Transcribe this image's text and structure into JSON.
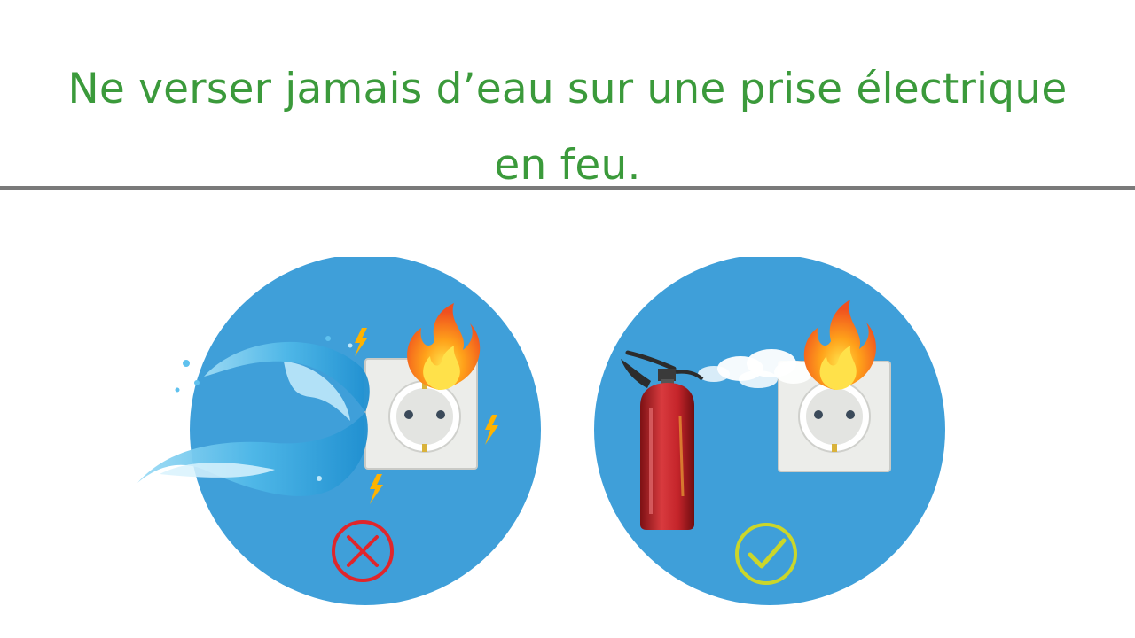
{
  "slide": {
    "title_line1": "Ne verser jamais d’eau sur une prise électrique",
    "title_line2": "en feu."
  },
  "panels": [
    {
      "id": "wrong",
      "depicts": [
        "water-splash-icon",
        "electrical-outlet-icon",
        "fire-icon",
        "lightning-icon"
      ],
      "verdict_icon": "cross-mark-icon",
      "verdict_color": "#e0262b"
    },
    {
      "id": "right",
      "depicts": [
        "fire-extinguisher-icon",
        "extinguisher-spray-icon",
        "electrical-outlet-icon",
        "fire-icon"
      ],
      "verdict_icon": "check-mark-icon",
      "verdict_color": "#cbd62a"
    }
  ],
  "colors": {
    "title": "#3b9a3b",
    "divider": "#7a7a7a",
    "circle": "#3f9fd9",
    "outlet": "#ecedea",
    "extinguisher": "#c4242a"
  }
}
